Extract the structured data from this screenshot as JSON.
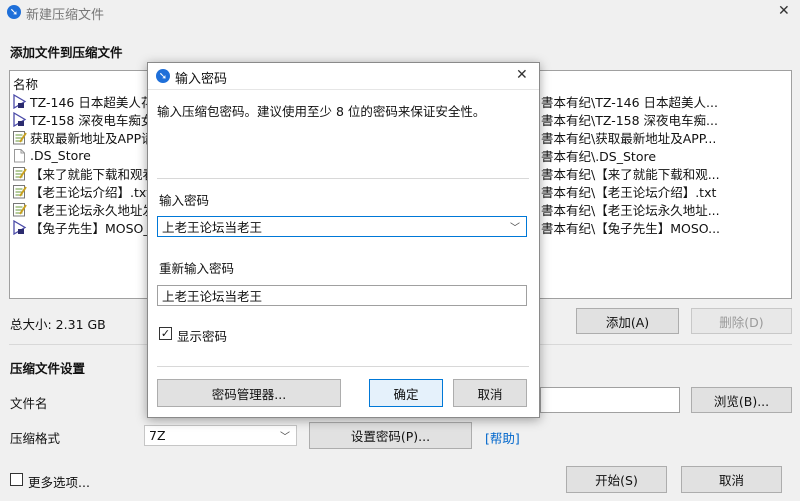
{
  "window": {
    "title": "新建压缩文件",
    "close_glyph": "✕"
  },
  "files_section": {
    "heading": "添加文件到压缩文件",
    "column_name": "名称",
    "rows": [
      {
        "name": "TZ-146 日本超美人花",
        "path": "書本有纪\\TZ-146 日本超美人...",
        "icon": "video-file-icon"
      },
      {
        "name": "TZ-158 深夜电车痴女",
        "path": "書本有纪\\TZ-158 深夜电车痴...",
        "icon": "video-file-icon"
      },
      {
        "name": "获取最新地址及APP请",
        "path": "書本有纪\\获取最新地址及APP...",
        "icon": "text-file-icon"
      },
      {
        "name": ".DS_Store",
        "path": "書本有纪\\.DS_Store",
        "icon": "blank-file-icon"
      },
      {
        "name": "【来了就能下载和观看",
        "path": "書本有纪\\【来了就能下载和观...",
        "icon": "text-file-icon"
      },
      {
        "name": "【老王论坛介绍】.txt",
        "path": "書本有纪\\【老王论坛介绍】.txt",
        "icon": "text-file-icon"
      },
      {
        "name": "【老王论坛永久地址发",
        "path": "書本有纪\\【老王论坛永久地址...",
        "icon": "text-file-icon"
      },
      {
        "name": "【兔子先生】MOSO_",
        "path": "書本有纪\\【兔子先生】MOSO...",
        "icon": "video-file-icon"
      }
    ],
    "total_size": "总大小: 2.31 GB",
    "add_button": "添加(A)",
    "delete_button": "删除(D)"
  },
  "settings_section": {
    "heading": "压缩文件设置",
    "filename_label": "文件名",
    "filename_value": "",
    "browse_button": "浏览(B)...",
    "format_label": "压缩格式",
    "format_value": "7Z",
    "set_password_button": "设置密码(P)...",
    "help_link": "[帮助]"
  },
  "footer": {
    "more_options": "更多选项...",
    "start_button": "开始(S)",
    "cancel_button": "取消"
  },
  "password_dialog": {
    "title": "输入密码",
    "description": "输入压缩包密码。建议使用至少 8 位的密码来保证安全性。",
    "password_label": "输入密码",
    "password_value": "上老王论坛当老王",
    "reenter_label": "重新输入密码",
    "reenter_value": "上老王论坛当老王",
    "show_password_label": "显示密码",
    "show_password_checked": true,
    "manager_button": "密码管理器...",
    "ok_button": "确定",
    "cancel_button": "取消"
  },
  "colors": {
    "accent": "#0078d7",
    "link": "#0066cc",
    "app_icon": "#1e6fd9"
  }
}
